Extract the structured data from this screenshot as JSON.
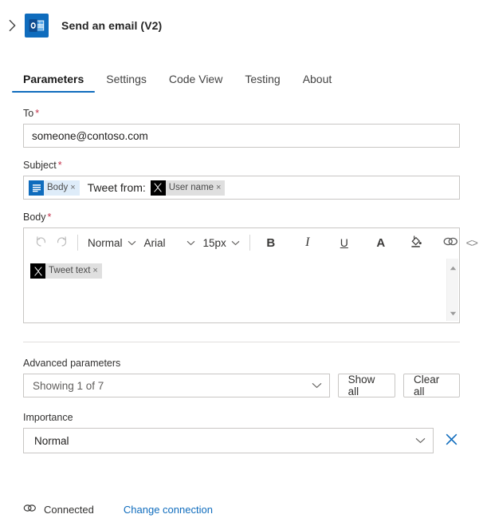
{
  "header": {
    "expand_icon": "chevron-right-icon",
    "app_icon": "outlook-icon",
    "title": "Send an email (V2)"
  },
  "tabs": [
    {
      "label": "Parameters",
      "active": true
    },
    {
      "label": "Settings",
      "active": false
    },
    {
      "label": "Code View",
      "active": false
    },
    {
      "label": "Testing",
      "active": false
    },
    {
      "label": "About",
      "active": false
    }
  ],
  "fields": {
    "to": {
      "label": "To",
      "required": "*",
      "value": "someone@contoso.com"
    },
    "subject": {
      "label": "Subject",
      "required": "*",
      "tokens": [
        {
          "type": "dynamic-blue",
          "icon": "body-lines-icon",
          "text": "Body",
          "close": "×"
        },
        {
          "type": "text",
          "text": "Tweet from:"
        },
        {
          "type": "dynamic-x",
          "icon": "x-twitter-icon",
          "text": "User name",
          "close": "×"
        }
      ]
    },
    "body": {
      "label": "Body",
      "required": "*",
      "toolbar": {
        "undo": "undo-icon",
        "redo": "redo-icon",
        "style": "Normal",
        "font": "Arial",
        "size": "15px",
        "bold": "B",
        "italic": "I",
        "underline": "U",
        "font_color": "A",
        "highlight": "highlight-icon",
        "link": "link-icon",
        "code": "<>"
      },
      "tokens": [
        {
          "type": "dynamic-x",
          "icon": "x-twitter-icon",
          "text": "Tweet text",
          "close": "×"
        }
      ]
    }
  },
  "advanced": {
    "label": "Advanced parameters",
    "selected": "Showing 1 of 7",
    "show_all_label": "Show all",
    "clear_all_label": "Clear all"
  },
  "importance": {
    "label": "Importance",
    "value": "Normal",
    "clear_icon": "close-x-icon"
  },
  "footer": {
    "status_icon": "link-chain-icon",
    "status": "Connected",
    "change_link": "Change connection"
  },
  "colors": {
    "accent": "#0f6cbd",
    "required": "#c4314b",
    "border": "#c8c6c4",
    "chip_blue_bg": "#deecf9",
    "chip_gray_bg": "#dfdfdf",
    "x_black": "#000000"
  }
}
